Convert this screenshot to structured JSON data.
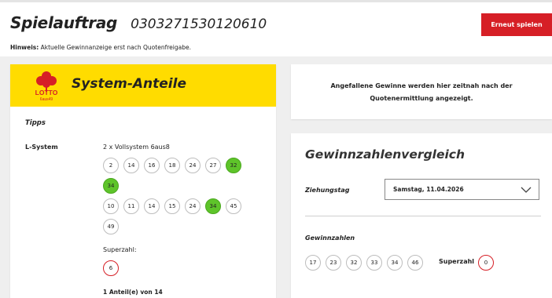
{
  "header": {
    "title": "Spielauftrag",
    "order_number": "0303271530120610",
    "hint_label": "Hinweis:",
    "hint_text": "Aktuelle Gewinnanzeige erst nach Quotenfreigabe.",
    "replay_button": "Erneut spielen"
  },
  "system_card": {
    "title": "System-Anteile",
    "logo_text": "LOTTO",
    "logo_sub": "6aus49",
    "tipps_label": "Tipps",
    "lsystem_label": "L-System",
    "system_type": "2 x Vollsystem 6aus8",
    "row1": [
      {
        "n": "2",
        "hit": false
      },
      {
        "n": "14",
        "hit": false
      },
      {
        "n": "16",
        "hit": false
      },
      {
        "n": "18",
        "hit": false
      },
      {
        "n": "24",
        "hit": false
      },
      {
        "n": "27",
        "hit": false
      },
      {
        "n": "32",
        "hit": true
      },
      {
        "n": "34",
        "hit": true
      }
    ],
    "row2": [
      {
        "n": "10",
        "hit": false
      },
      {
        "n": "11",
        "hit": false
      },
      {
        "n": "14",
        "hit": false
      },
      {
        "n": "15",
        "hit": false
      },
      {
        "n": "24",
        "hit": false
      },
      {
        "n": "34",
        "hit": true
      },
      {
        "n": "45",
        "hit": false
      },
      {
        "n": "49",
        "hit": false
      }
    ],
    "superzahl_label": "Superzahl:",
    "superzahl": "6",
    "anteil_text": "1 Anteil(e) von 14"
  },
  "info_card": {
    "line1": "Angefallene Gewinne werden hier zeitnah nach der",
    "line2": "Quotenermittlung angezeigt."
  },
  "compare_card": {
    "title": "Gewinnzahlenvergleich",
    "draw_date_label": "Ziehungstag",
    "draw_date_value": "Samstag, 11.04.2026",
    "winning_label": "Gewinnzahlen",
    "winning_numbers": [
      "17",
      "23",
      "32",
      "33",
      "34",
      "46"
    ],
    "superzahl_label": "Superzahl",
    "superzahl": "0"
  },
  "colors": {
    "brand_red": "#d61f26",
    "lotto_yellow": "#ffdc00",
    "hit_green": "#5ec42a"
  }
}
